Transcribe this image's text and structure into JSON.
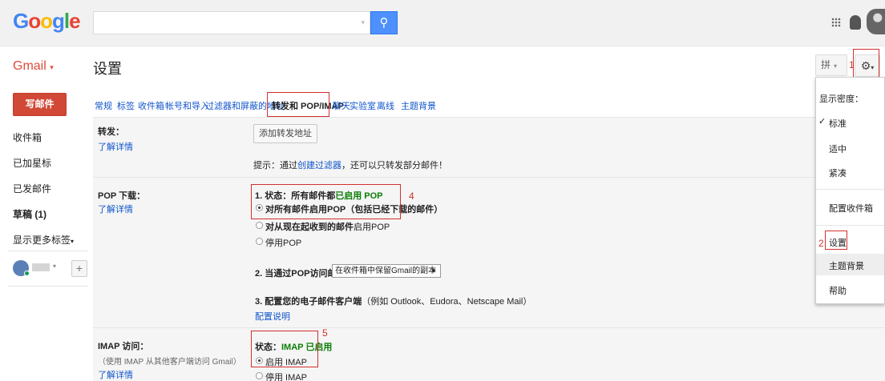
{
  "header": {
    "logo": {
      "g1": "G",
      "o1": "o",
      "o2": "o",
      "g2": "g",
      "l": "l",
      "e": "e"
    },
    "search_placeholder": "",
    "icons": [
      "search-icon",
      "apps-icon",
      "bell-icon"
    ]
  },
  "gmail": {
    "brand": "Gmail",
    "page_title": "设置",
    "ime": "拼",
    "step1": "1",
    "step2": "2",
    "step4": "4",
    "step5": "5"
  },
  "sidebar": {
    "compose": "写邮件",
    "items": [
      "收件箱",
      "已加星标",
      "已发邮件",
      "草稿 (1)",
      "显示更多标签"
    ]
  },
  "tabs": [
    "常规",
    "标签",
    "收件箱",
    "帐号和导入",
    "过滤器和屏蔽的地址",
    "转发和 POP/IMAP",
    "聊天",
    "实验室",
    "离线",
    "主题背景"
  ],
  "forwarding": {
    "label": "转发：",
    "learn_more": "了解详情",
    "add_button": "添加转发地址",
    "tip_prefix": "提示：通过",
    "tip_link": "创建过滤器",
    "tip_suffix": "，还可以只转发部分邮件！"
  },
  "pop": {
    "label": "POP 下载：",
    "learn_more": "了解详情",
    "status_prefix": "1. 状态：所有邮件都",
    "status_value": "已启用 POP",
    "option_all": "对所有邮件启用POP（包括已经下载的邮件）",
    "option_from_now_prefix": "对从现在起收到的",
    "option_from_now_bold": "邮件",
    "option_from_now_suffix": "启用POP",
    "option_disable": "停用POP",
    "access_label": "2. 当通过POP访问邮件时",
    "access_select": "在收件箱中保留Gmail的副本",
    "client_label": "3. 配置您的电子邮件客户端",
    "client_hint": "（例如 Outlook、Eudora、Netscape Mail）",
    "client_link": "配置说明"
  },
  "imap": {
    "label": "IMAP 访问：",
    "note": "（使用 IMAP 从其他客户端访问 Gmail）",
    "learn_more": "了解详情",
    "status_prefix": "状态：",
    "status_value": "IMAP 已启用",
    "option_enable": "启用 IMAP",
    "option_disable": "停用 IMAP"
  },
  "dropdown": {
    "density_title": "显示密度：",
    "check": "✓",
    "density_standard": "标准",
    "density_comfortable": "适中",
    "density_compact": "紧凑",
    "configure_inbox": "配置收件箱",
    "settings": "设置",
    "themes": "主题背景",
    "help": "帮助"
  },
  "colors": {
    "accent_red": "#dd4b39",
    "link": "#1155cc",
    "annotation": "#d32f2f",
    "enabled_green": "#0a7e07"
  }
}
